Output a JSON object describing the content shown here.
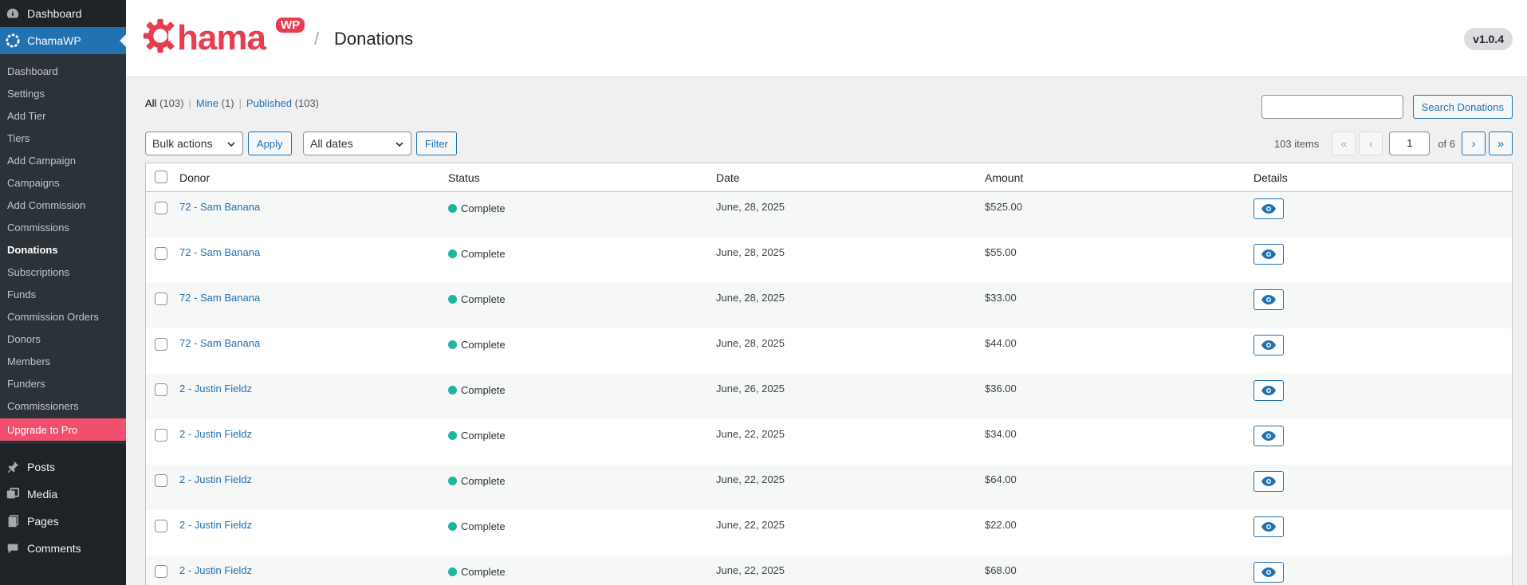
{
  "sidebar": {
    "top": [
      {
        "label": "Dashboard",
        "icon": "dashboard-icon"
      },
      {
        "label": "ChamaWP",
        "icon": "chamawp-icon"
      }
    ],
    "submenu": [
      "Dashboard",
      "Settings",
      "Add Tier",
      "Tiers",
      "Add Campaign",
      "Campaigns",
      "Add Commission",
      "Commissions",
      "Donations",
      "Subscriptions",
      "Funds",
      "Commission Orders",
      "Donors",
      "Members",
      "Funders",
      "Commissioners",
      "Upgrade to Pro"
    ],
    "current": "Donations",
    "lower": [
      {
        "label": "Posts",
        "icon": "pin-icon"
      },
      {
        "label": "Media",
        "icon": "media-icon"
      },
      {
        "label": "Pages",
        "icon": "pages-icon"
      },
      {
        "label": "Comments",
        "icon": "comments-icon"
      }
    ]
  },
  "header": {
    "logo_text": "hama",
    "logo_badge": "WP",
    "separator": "/",
    "title": "Donations",
    "version": "v1.0.4"
  },
  "filters": {
    "all": "All",
    "all_count": "(103)",
    "mine": "Mine",
    "mine_count": "(1)",
    "published": "Published",
    "published_count": "(103)",
    "sep": "|"
  },
  "search": {
    "value": "",
    "button": "Search Donations"
  },
  "tablenav": {
    "bulk_actions": "Bulk actions",
    "apply": "Apply",
    "dates": "All dates",
    "filter": "Filter",
    "items": "103 items",
    "first": "«",
    "prev": "‹",
    "next": "›",
    "last": "»",
    "page": "1",
    "of": "of 6"
  },
  "table": {
    "columns": [
      "Donor",
      "Status",
      "Date",
      "Amount",
      "Details"
    ],
    "rows": [
      {
        "donor": "72 - Sam Banana",
        "status": "Complete",
        "date": "June, 28, 2025",
        "amount": "$525.00"
      },
      {
        "donor": "72 - Sam Banana",
        "status": "Complete",
        "date": "June, 28, 2025",
        "amount": "$55.00"
      },
      {
        "donor": "72 - Sam Banana",
        "status": "Complete",
        "date": "June, 28, 2025",
        "amount": "$33.00"
      },
      {
        "donor": "72 - Sam Banana",
        "status": "Complete",
        "date": "June, 28, 2025",
        "amount": "$44.00"
      },
      {
        "donor": "2 - Justin Fieldz",
        "status": "Complete",
        "date": "June, 26, 2025",
        "amount": "$36.00"
      },
      {
        "donor": "2 - Justin Fieldz",
        "status": "Complete",
        "date": "June, 22, 2025",
        "amount": "$34.00"
      },
      {
        "donor": "2 - Justin Fieldz",
        "status": "Complete",
        "date": "June, 22, 2025",
        "amount": "$64.00"
      },
      {
        "donor": "2 - Justin Fieldz",
        "status": "Complete",
        "date": "June, 22, 2025",
        "amount": "$22.00"
      },
      {
        "donor": "2 - Justin Fieldz",
        "status": "Complete",
        "date": "June, 22, 2025",
        "amount": "$68.00"
      }
    ]
  },
  "colors": {
    "accent": "#2271b1",
    "brand": "#e83d4f",
    "status_complete": "#1fb5a0",
    "upgrade": "#f0506e"
  }
}
